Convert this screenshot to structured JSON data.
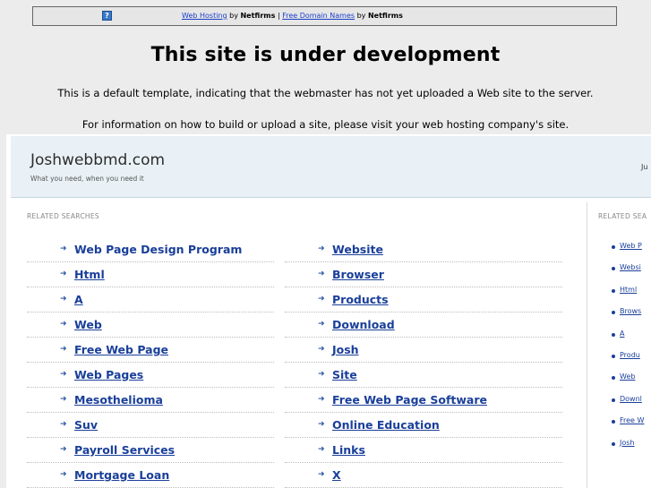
{
  "topbar": {
    "icon": "help-question-icon",
    "link1": "Web Hosting",
    "by1": " by ",
    "brand1": "Netfirms",
    "sep": " | ",
    "link2": "Free Domain Names",
    "by2": " by ",
    "brand2": "Netfirms"
  },
  "notice": {
    "title": "This site is under development",
    "line1": "This is a default template, indicating that the webmaster has not yet uploaded a Web site to the server.",
    "line2": "For information on how to build or upload a site, please visit your web hosting company's site."
  },
  "parked": {
    "site_name": "Joshwebbmd.com",
    "tagline": "What you need, when you need it",
    "header_right": "Ju",
    "related_label": "RELATED SEARCHES",
    "related_label_right": "RELATED SEA",
    "left_column": [
      "Web Page Design Program",
      "Html",
      "A",
      "Web",
      "Free Web Page",
      "Web Pages",
      "Mesothelioma",
      "Suv",
      "Payroll Services",
      "Mortgage Loan"
    ],
    "mid_column": [
      "Website",
      "Browser",
      "Products",
      "Download",
      "Josh",
      "Site",
      "Free Web Page Software",
      "Online Education",
      "Links",
      "X"
    ],
    "side_column": [
      "Web P",
      "Websi",
      "Html",
      "Brows",
      "A",
      "Produ",
      "Web",
      "Downl",
      "Free W",
      "Josh"
    ]
  }
}
